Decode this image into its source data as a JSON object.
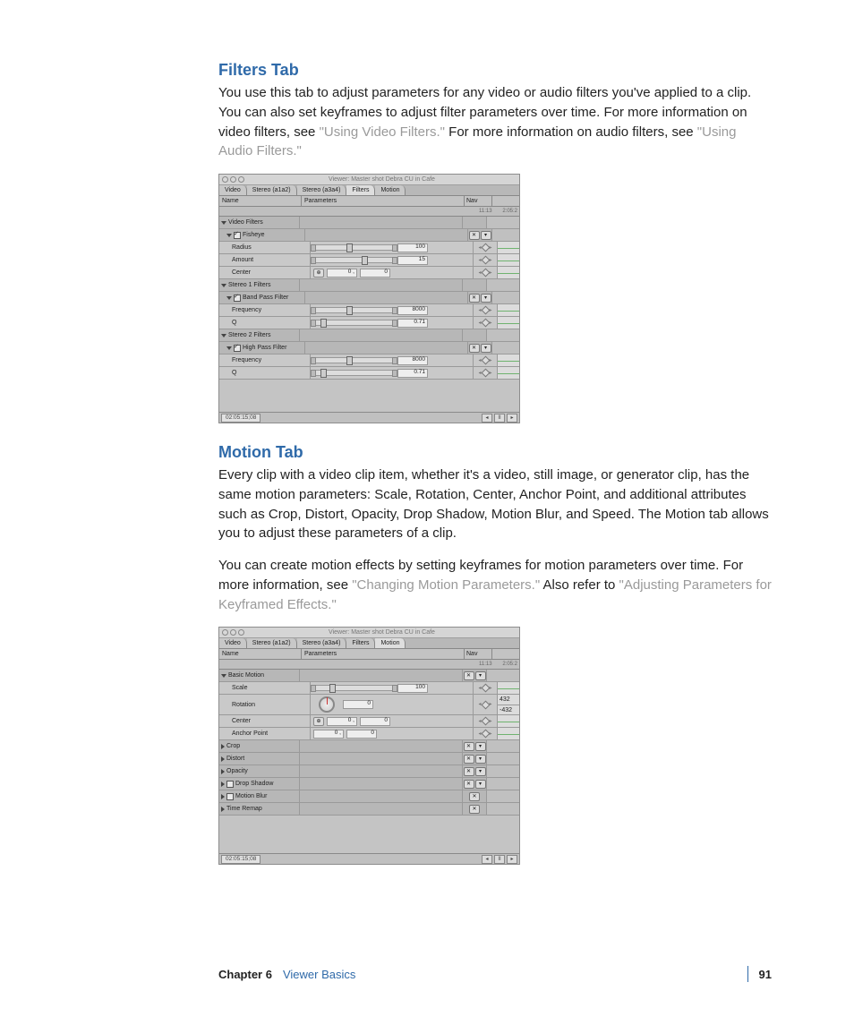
{
  "sections": {
    "filters": {
      "heading": "Filters Tab",
      "para_a": "You use this tab to adjust parameters for any video or audio filters you've applied to a clip. You can also set keyframes to adjust filter parameters over time. For more information on video filters, see ",
      "link_a": "\"Using Video Filters.\"",
      "para_b": " For more information on audio filters, see ",
      "link_b": "\"Using Audio Filters.\""
    },
    "motion": {
      "heading": "Motion Tab",
      "para_a": "Every clip with a video clip item, whether it's a video, still image, or generator clip, has the same motion parameters: Scale, Rotation, Center, Anchor Point, and additional attributes such as Crop, Distort, Opacity, Drop Shadow, Motion Blur, and Speed. The Motion tab allows you to adjust these parameters of a clip.",
      "para_b": "You can create motion effects by setting keyframes for motion parameters over time. For more information, see ",
      "link_a": "\"Changing Motion Parameters.\"",
      "para_c": " Also refer to ",
      "link_b": "\"Adjusting Parameters for Keyframed Effects.\""
    }
  },
  "shot_common": {
    "window_title": "Viewer: Master shot Debra CU in Cafe",
    "tabs": [
      "Video",
      "Stereo (a1a2)",
      "Stereo (a3a4)",
      "Filters",
      "Motion"
    ],
    "headers": {
      "name": "Name",
      "parameters": "Parameters",
      "nav": "Nav"
    },
    "ruler_left": "11:13",
    "ruler_right": "2:05:2",
    "timecode": "02:05:15;08",
    "foot_tiny": "I  II"
  },
  "filters_shot": {
    "active_tab": "Filters",
    "groups": [
      {
        "title": "Video Filters",
        "filters": [
          {
            "name": "Fisheye",
            "checked": true,
            "params": [
              {
                "label": "Radius",
                "value": "100",
                "pos": 40
              },
              {
                "label": "Amount",
                "value": "15",
                "pos": 60
              },
              {
                "label": "Center",
                "type": "center",
                "vx": "0",
                "vy": "0"
              }
            ]
          }
        ]
      },
      {
        "title": "Stereo 1 Filters",
        "filters": [
          {
            "name": "Band Pass Filter",
            "checked": true,
            "params": [
              {
                "label": "Frequency",
                "value": "8000",
                "pos": 40
              },
              {
                "label": "Q",
                "value": "0.71",
                "pos": 6
              }
            ]
          }
        ]
      },
      {
        "title": "Stereo 2 Filters",
        "filters": [
          {
            "name": "High Pass Filter",
            "checked": true,
            "params": [
              {
                "label": "Frequency",
                "value": "8000",
                "pos": 40
              },
              {
                "label": "Q",
                "value": "0.71",
                "pos": 6
              }
            ]
          }
        ]
      }
    ],
    "blank_height": 36
  },
  "motion_shot": {
    "active_tab": "Motion",
    "basic_label": "Basic Motion",
    "params": [
      {
        "label": "Scale",
        "type": "slider",
        "value": "100",
        "pos": 18
      },
      {
        "label": "Rotation",
        "type": "dial",
        "value": "0",
        "sideA": "432",
        "sideB": "-432"
      },
      {
        "label": "Center",
        "type": "center",
        "vx": "0",
        "vy": "0"
      },
      {
        "label": "Anchor Point",
        "type": "pair",
        "vx": "0",
        "vy": "0"
      }
    ],
    "collapsed": [
      {
        "label": "Crop",
        "reset": true,
        "menu": true
      },
      {
        "label": "Distort",
        "reset": true,
        "menu": true
      },
      {
        "label": "Opacity",
        "reset": true,
        "menu": true
      },
      {
        "label": "Drop Shadow",
        "reset": true,
        "menu": true,
        "checkbox": true,
        "checked": false
      },
      {
        "label": "Motion Blur",
        "reset": true,
        "menu": false,
        "checkbox": true,
        "checked": false
      },
      {
        "label": "Time Remap",
        "reset": true,
        "menu": false
      }
    ],
    "blank_height": 42
  },
  "footer": {
    "chapter": "Chapter 6",
    "title": "Viewer Basics",
    "page": "91"
  }
}
